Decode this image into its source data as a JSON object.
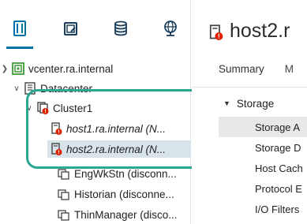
{
  "nav_tabs": [
    {
      "name": "hosts-and-clusters-tab",
      "icon": "hosts-clusters-icon",
      "selected": true
    },
    {
      "name": "vms-and-templates-tab",
      "icon": "vm-template-icon",
      "selected": false
    },
    {
      "name": "storage-tab",
      "icon": "database-icon",
      "selected": false
    },
    {
      "name": "networking-tab",
      "icon": "globe-network-icon",
      "selected": false
    }
  ],
  "tree": {
    "vcenter": {
      "label": "vcenter.ra.internal",
      "icon": "vcenter-icon"
    },
    "datacenter": {
      "label": "Datacenter",
      "icon": "datacenter-icon"
    },
    "cluster": {
      "label": "Cluster1",
      "icon": "cluster-error-icon"
    },
    "host1": {
      "label": "host1.ra.internal (N...",
      "icon": "host-error-icon"
    },
    "host2": {
      "label": "host2.ra.internal (N...",
      "icon": "host-error-icon",
      "selected": true
    },
    "vm1": {
      "label": "EngWkStn (disconn...",
      "icon": "vm-icon"
    },
    "vm2": {
      "label": "Historian (disconne...",
      "icon": "vm-icon"
    },
    "vm3": {
      "label": "ThinManager (disco...",
      "icon": "vm-icon"
    }
  },
  "content": {
    "title": "host2.r",
    "title_icon": "host-error-icon",
    "tabs": [
      "Summary",
      "M"
    ],
    "menu_group": "Storage",
    "menu_items": [
      {
        "label": "Storage A",
        "active": true
      },
      {
        "label": "Storage D",
        "active": false
      },
      {
        "label": "Host Cach",
        "active": false
      },
      {
        "label": "Protocol E",
        "active": false
      },
      {
        "label": "I/O Filters",
        "active": false
      }
    ]
  },
  "colors": {
    "accent": "#0072a3",
    "highlight_ring": "#2ba88f",
    "error_badge": "#e12200",
    "vcenter_green": "#3f9a36",
    "selected_row": "#d9e4ea"
  }
}
